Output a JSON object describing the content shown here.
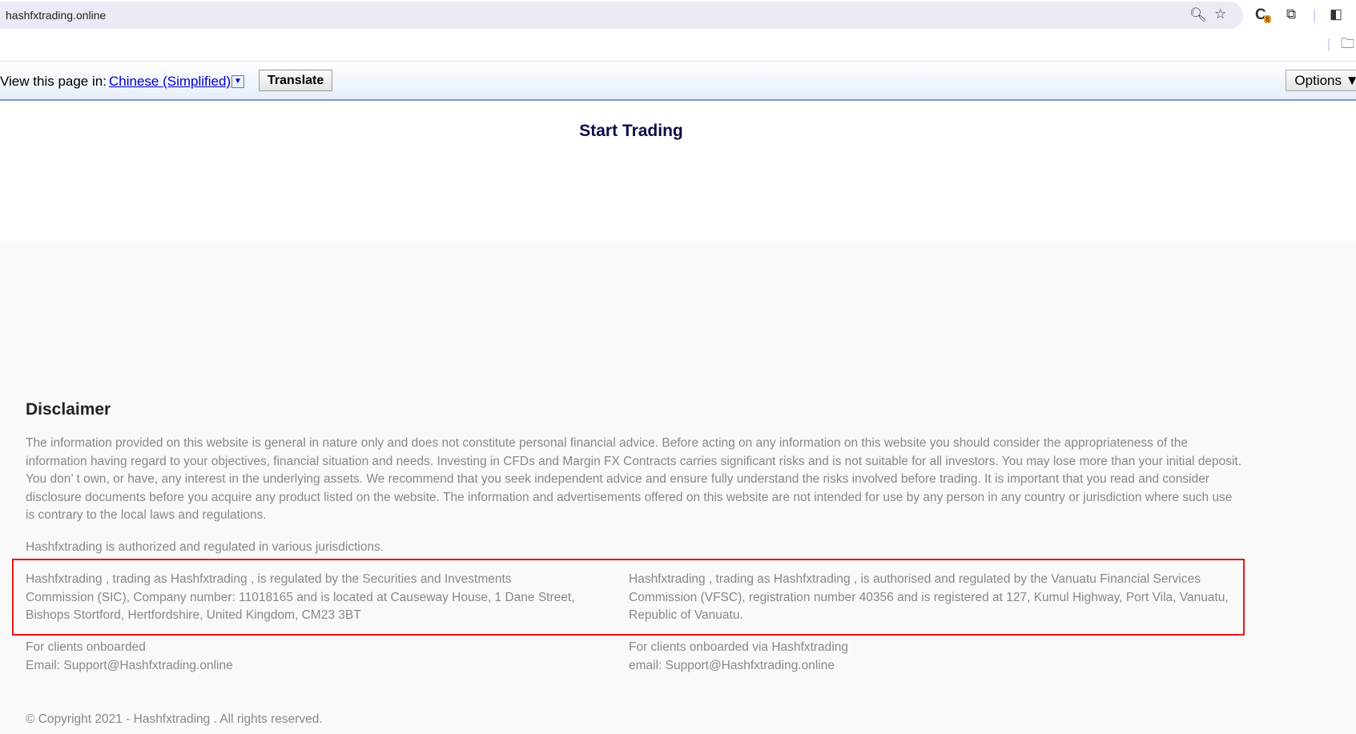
{
  "browser": {
    "url": "hashfxtrading.online",
    "extension_badge": "8"
  },
  "translate_bar": {
    "label": "View this page in:",
    "language": "Chinese (Simplified)",
    "translate_button": "Translate",
    "options_button": "Options ▼"
  },
  "hero": {
    "start_trading": "Start Trading"
  },
  "disclaimer": {
    "title": "Disclaimer",
    "body": "The information provided on this website is general in nature only and does not constitute personal financial advice. Before acting on any information on this website you should consider the appropriateness of the information having regard to your objectives, financial situation and needs. Investing in CFDs and Margin FX Contracts carries significant risks and is not suitable for all investors. You may lose more than your initial deposit. You don’ t own, or have, any interest in the underlying assets. We recommend that you seek independent advice and ensure fully understand the risks involved before trading. It is important that you read and consider disclosure documents before you acquire any product listed on the website. The information and advertisements offered on this website are not intended for use by any person in any country or jurisdiction where such use is contrary to the local laws and regulations.",
    "authorized": "Hashfxtrading is authorized and regulated in various jurisdictions.",
    "regulation_left": "Hashfxtrading , trading as Hashfxtrading , is regulated by the Securities and Investments Commission (SIC), Company number: 11018165 and is located at Causeway House, 1 Dane Street, Bishops Stortford, Hertfordshire, United Kingdom, CM23 3BT",
    "regulation_right": "Hashfxtrading , trading as Hashfxtrading , is authorised and regulated by the Vanuatu Financial Services Commission (VFSC), registration number 40356 and is registered at 127, Kumul Highway, Port Vila, Vanuatu, Republic of Vanuatu.",
    "contact_left_title": "For clients onboarded",
    "contact_left_email": "Email: Support@Hashfxtrading.online",
    "contact_right_title": "For clients onboarded via Hashfxtrading",
    "contact_right_email": "email: Support@Hashfxtrading.online",
    "copyright": "© Copyright 2021 - Hashfxtrading . All rights reserved."
  }
}
